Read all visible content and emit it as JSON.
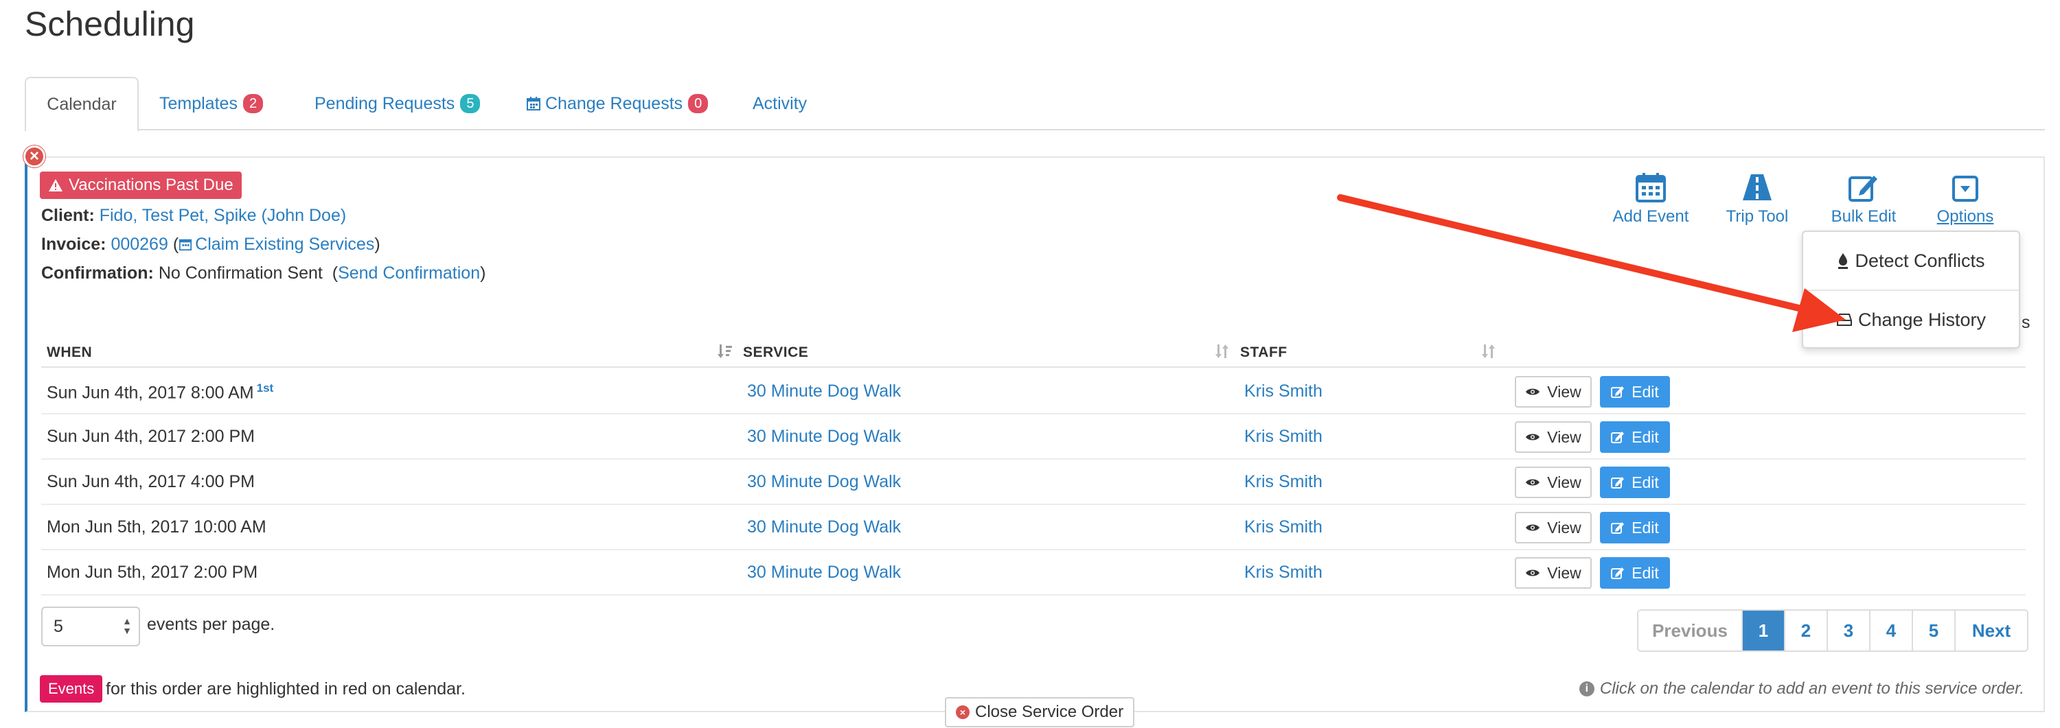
{
  "page": {
    "title": "Scheduling"
  },
  "tabs": [
    {
      "label": "Calendar"
    },
    {
      "label": "Templates",
      "badge": "2"
    },
    {
      "label": "Pending Requests",
      "badge": "5"
    },
    {
      "label": "Change Requests",
      "badge": "0"
    },
    {
      "label": "Activity"
    }
  ],
  "order": {
    "alert": "Vaccinations Past Due",
    "client_label": "Client:",
    "client_value": "Fido, Test Pet, Spike (John Doe)",
    "invoice_label": "Invoice:",
    "invoice_number": "000269",
    "claim_services": "Claim Existing Services",
    "confirmation_label": "Confirmation:",
    "confirmation_value": "No Confirmation Sent",
    "send_confirmation": "Send Confirmation"
  },
  "toolbar": {
    "add_event": "Add Event",
    "trip_tool": "Trip Tool",
    "bulk_edit": "Bulk Edit",
    "options": "Options"
  },
  "options_menu": {
    "detect_conflicts": "Detect Conflicts",
    "change_history": "Change History",
    "partial_text": "s"
  },
  "table": {
    "columns": [
      "WHEN",
      "SERVICE",
      "STAFF"
    ],
    "rows": [
      {
        "when": "Sun Jun 4th, 2017 8:00 AM",
        "marker": "1st",
        "service": "30 Minute Dog Walk",
        "staff": "Kris Smith"
      },
      {
        "when": "Sun Jun 4th, 2017 2:00 PM",
        "marker": "",
        "service": "30 Minute Dog Walk",
        "staff": "Kris Smith"
      },
      {
        "when": "Sun Jun 4th, 2017 4:00 PM",
        "marker": "",
        "service": "30 Minute Dog Walk",
        "staff": "Kris Smith"
      },
      {
        "when": "Mon Jun 5th, 2017 10:00 AM",
        "marker": "",
        "service": "30 Minute Dog Walk",
        "staff": "Kris Smith"
      },
      {
        "when": "Mon Jun 5th, 2017 2:00 PM",
        "marker": "",
        "service": "30 Minute Dog Walk",
        "staff": "Kris Smith"
      }
    ],
    "view_label": "View",
    "edit_label": "Edit"
  },
  "pagination": {
    "per_page_value": "5",
    "per_page_label": "events per page.",
    "previous": "Previous",
    "pages": [
      "1",
      "2",
      "3",
      "4",
      "5"
    ],
    "current": "1",
    "next": "Next"
  },
  "footer": {
    "events_tag": "Events",
    "events_note": "for this order are highlighted in red on calendar.",
    "calendar_hint": "Click on the calendar to add an event to this service order.",
    "close_order": "Close Service Order"
  },
  "colors": {
    "link": "#2a7ec0",
    "danger": "#e04b5f",
    "primary_button": "#3a97e8",
    "annotation_arrow": "#f03a22"
  }
}
